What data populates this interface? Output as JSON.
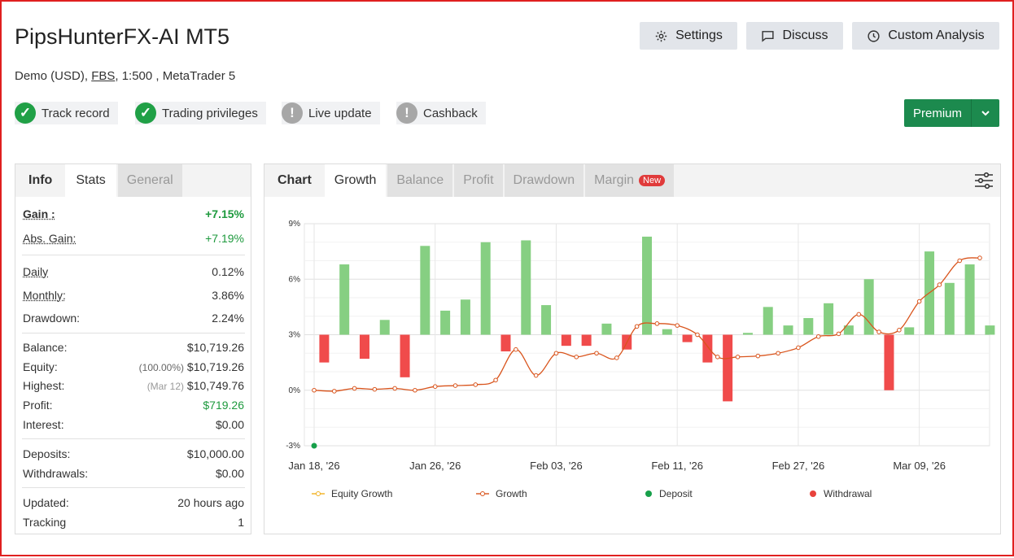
{
  "header": {
    "title": "PipsHunterFX-AI MT5",
    "account_type": "Demo (USD),",
    "broker": "FBS",
    "leverage_platform": ", 1:500 , MetaTrader 5"
  },
  "toolbar": {
    "settings_label": "Settings",
    "discuss_label": "Discuss",
    "custom_analysis_label": "Custom Analysis"
  },
  "badges": [
    {
      "label": "Track record",
      "status": "verified",
      "icon": "check-icon"
    },
    {
      "label": "Trading privileges",
      "status": "verified",
      "icon": "check-icon"
    },
    {
      "label": "Live update",
      "status": "unverified",
      "icon": "exclamation-icon"
    },
    {
      "label": "Cashback",
      "status": "unverified",
      "icon": "exclamation-icon"
    }
  ],
  "premium": {
    "label": "Premium"
  },
  "stats_panel": {
    "tabs": [
      "Info",
      "Stats",
      "General"
    ],
    "rows": {
      "gain": {
        "label": "Gain :",
        "value": "+7.15%"
      },
      "abs_gain": {
        "label": "Abs. Gain:",
        "value": "+7.19%"
      },
      "daily": {
        "label": "Daily",
        "value": "0.12%"
      },
      "monthly": {
        "label": "Monthly:",
        "value": "3.86%"
      },
      "drawdown": {
        "label": "Drawdown:",
        "value": "2.24%"
      },
      "balance": {
        "label": "Balance:",
        "value": "$10,719.26"
      },
      "equity": {
        "label": "Equity:",
        "note": "(100.00%)",
        "value": "$10,719.26"
      },
      "highest": {
        "label": "Highest:",
        "note": "(Mar 12)",
        "value": "$10,749.76"
      },
      "profit": {
        "label": "Profit:",
        "value": "$719.26"
      },
      "interest": {
        "label": "Interest:",
        "value": "$0.00"
      },
      "deposits": {
        "label": "Deposits:",
        "value": "$10,000.00"
      },
      "withdrawals": {
        "label": "Withdrawals:",
        "value": "$0.00"
      },
      "updated": {
        "label": "Updated:",
        "value": "20 hours ago"
      },
      "tracking": {
        "label": "Tracking",
        "value": "1"
      }
    }
  },
  "chart_panel": {
    "tabs": [
      "Chart",
      "Growth",
      "Balance",
      "Profit",
      "Drawdown",
      "Margin"
    ],
    "new_tag": "New",
    "active_tab": "Growth"
  },
  "colors": {
    "positive_bar": "#86cf82",
    "negative_bar": "#f04b4b",
    "growth_line": "#d9541c",
    "equity_line": "#f2b01e",
    "deposit": "#17a04a",
    "withdrawal": "#e8423c",
    "brand_green": "#1c8a4e"
  },
  "chart_data": {
    "type": "bar",
    "ylim": [
      -3,
      9
    ],
    "y_ticks": [
      "9%",
      "6%",
      "3%",
      "0%",
      "-3%"
    ],
    "y_tick_values": [
      9,
      6,
      3,
      0,
      -3
    ],
    "x_tick_labels": [
      "Jan 18, '26",
      "Jan 26, '26",
      "Feb 03, '26",
      "Feb 11, '26",
      "Feb 27, '26",
      "Mar 09, '26"
    ],
    "x_tick_indices": [
      0,
      6,
      12,
      18,
      24,
      30
    ],
    "n_points": 34,
    "daily_change_bars_baseline": 3,
    "daily_change_bars": [
      0,
      -1.5,
      3.8,
      -1.3,
      0.8,
      -2.3,
      4.8,
      1.3,
      1.9,
      5.0,
      -0.9,
      5.1,
      1.6,
      -0.6,
      -0.6,
      0.6,
      -0.8,
      5.3,
      0.3,
      -0.4,
      -1.5,
      -3.6,
      0.1,
      1.5,
      0.5,
      0.9,
      1.7,
      0.5,
      3.0,
      -3.0,
      0.4,
      4.5,
      2.8,
      3.8,
      0.5
    ],
    "series": [
      {
        "name": "Growth",
        "values": [
          0.0,
          -0.05,
          0.1,
          0.05,
          0.1,
          0.0,
          0.2,
          0.25,
          0.3,
          0.55,
          2.2,
          0.8,
          2.0,
          1.8,
          2.0,
          1.75,
          3.45,
          3.6,
          3.5,
          3.0,
          1.8,
          1.8,
          1.85,
          2.0,
          2.3,
          2.9,
          3.05,
          4.1,
          3.15,
          3.25,
          4.8,
          5.7,
          7.0,
          7.15
        ]
      },
      {
        "name": "Equity Growth",
        "values": []
      },
      {
        "name": "Deposit",
        "values": [
          -3.0
        ]
      },
      {
        "name": "Withdrawal",
        "values": []
      }
    ],
    "legend": [
      "Equity Growth",
      "Growth",
      "Deposit",
      "Withdrawal"
    ]
  }
}
